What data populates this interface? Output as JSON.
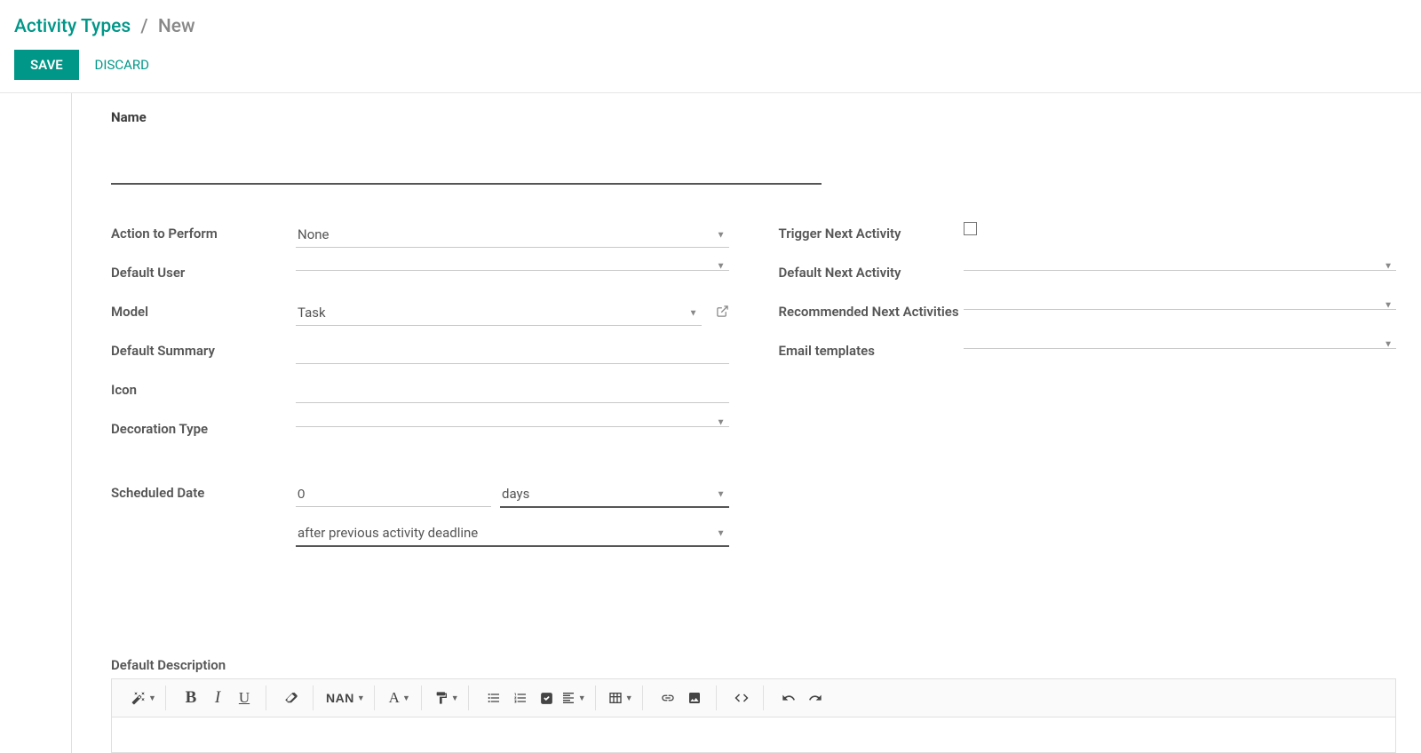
{
  "breadcrumb": {
    "parent": "Activity Types",
    "sep": "/",
    "current": "New"
  },
  "buttons": {
    "save": "SAVE",
    "discard": "DISCARD"
  },
  "labels": {
    "name": "Name",
    "action_to_perform": "Action to Perform",
    "default_user": "Default User",
    "model": "Model",
    "default_summary": "Default Summary",
    "icon": "Icon",
    "decoration_type": "Decoration Type",
    "scheduled_date": "Scheduled Date",
    "trigger_next": "Trigger Next Activity",
    "default_next": "Default Next Activity",
    "recommended_next": "Recommended Next Activities",
    "email_templates": "Email templates",
    "default_description": "Default Description"
  },
  "values": {
    "name": "",
    "action_to_perform": "None",
    "default_user": "",
    "model": "Task",
    "default_summary": "",
    "icon": "",
    "decoration_type": "",
    "sched_number": "0",
    "sched_unit": "days",
    "sched_relative": "after previous activity deadline",
    "default_next": "",
    "recommended_next": "",
    "email_templates": ""
  },
  "toolbar": {
    "font_size": "NAN"
  }
}
